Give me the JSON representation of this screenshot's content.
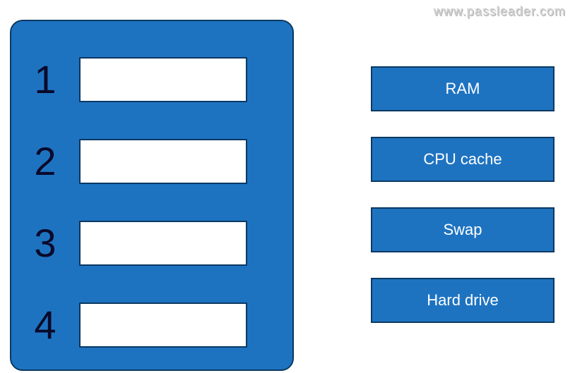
{
  "watermark": "www.passleader.com",
  "leftPanel": {
    "slots": [
      {
        "num": "1"
      },
      {
        "num": "2"
      },
      {
        "num": "3"
      },
      {
        "num": "4"
      }
    ]
  },
  "options": [
    {
      "label": "RAM"
    },
    {
      "label": "CPU cache"
    },
    {
      "label": "Swap"
    },
    {
      "label": "Hard drive"
    }
  ]
}
